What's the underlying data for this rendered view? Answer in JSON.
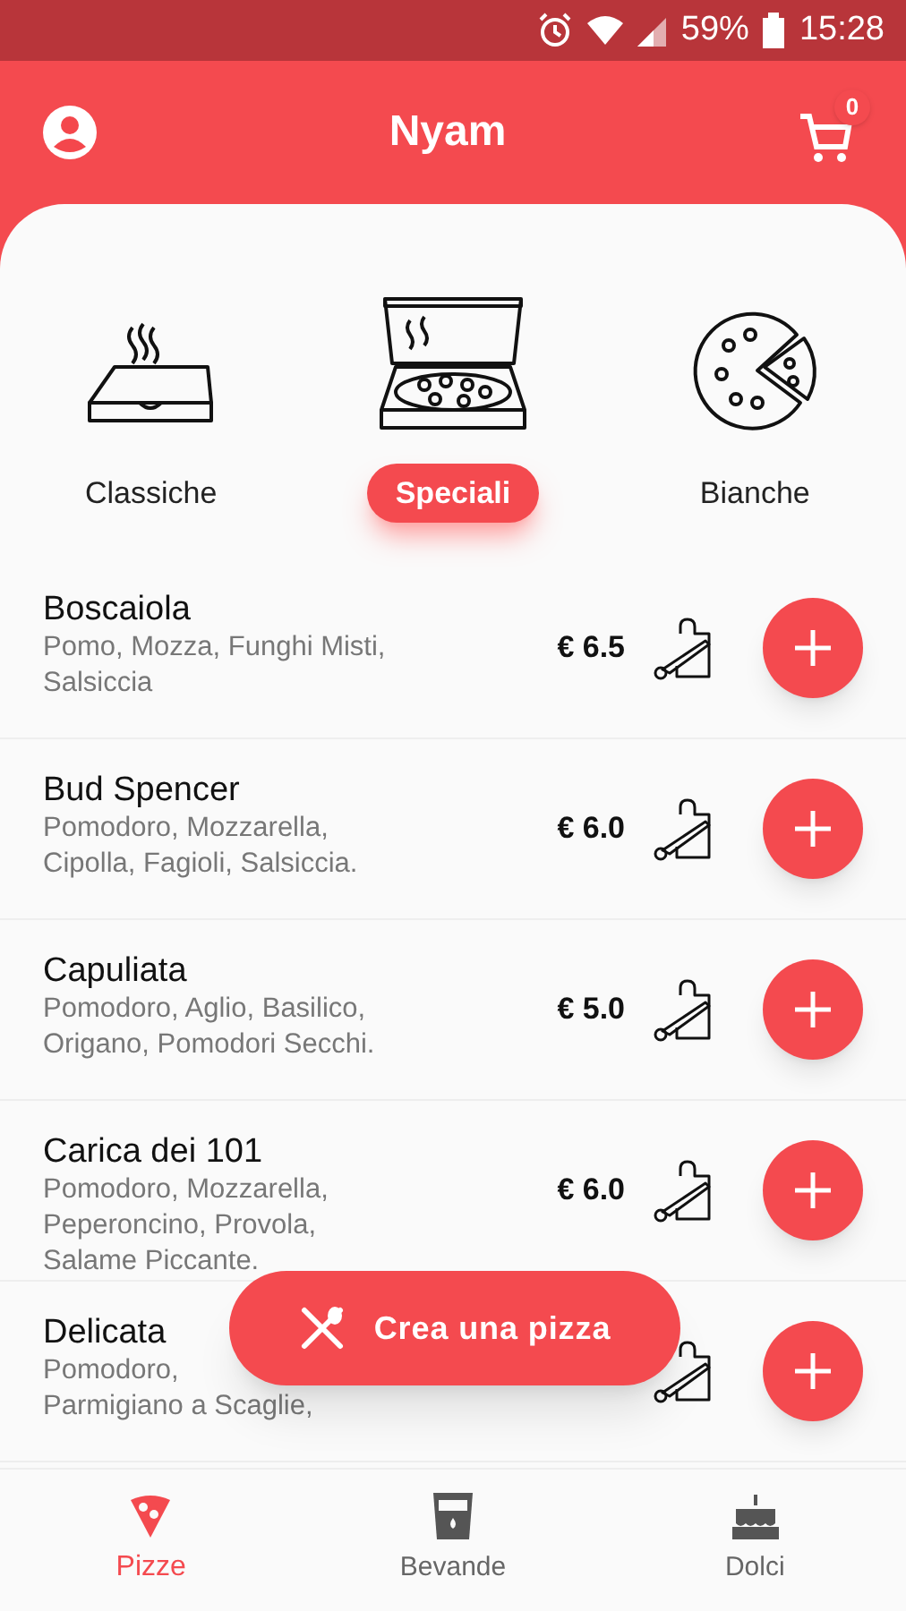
{
  "status_bar": {
    "battery": "59%",
    "time": "15:28"
  },
  "header": {
    "title": "Nyam",
    "cart_count": "0"
  },
  "categories": [
    {
      "kind": "closed-box",
      "label": "Classiche",
      "selected": false
    },
    {
      "kind": "open-box",
      "label": "Speciali",
      "selected": true
    },
    {
      "kind": "pizza",
      "label": "Bianche",
      "selected": false
    }
  ],
  "pizzas": [
    {
      "name": "Boscaiola",
      "description": [
        "Pomo, Mozza, Funghi Misti,",
        "Salsiccia"
      ],
      "price": "€ 6.5"
    },
    {
      "name": "Bud Spencer",
      "description": [
        "Pomodoro, Mozzarella,",
        "Cipolla, Fagioli, Salsiccia."
      ],
      "price": "€ 6.0"
    },
    {
      "name": "Capuliata",
      "description": [
        "Pomodoro, Aglio, Basilico,",
        "Origano, Pomodori Secchi."
      ],
      "price": "€ 5.0"
    },
    {
      "name": "Carica dei 101",
      "description": [
        "Pomodoro, Mozzarella,",
        "Peperoncino, Provola,",
        "Salame Piccante."
      ],
      "price": "€ 6.0"
    },
    {
      "name": "Delicata",
      "description": [
        "Pomodoro,",
        "Parmigiano a Scaglie,"
      ]
    }
  ],
  "fab": {
    "label": "Crea una pizza"
  },
  "bottom_nav": [
    {
      "kind": "pizza",
      "label": "Pizze",
      "selected": true
    },
    {
      "kind": "drink",
      "label": "Bevande",
      "selected": false
    },
    {
      "kind": "cake",
      "label": "Dolci",
      "selected": false
    }
  ]
}
